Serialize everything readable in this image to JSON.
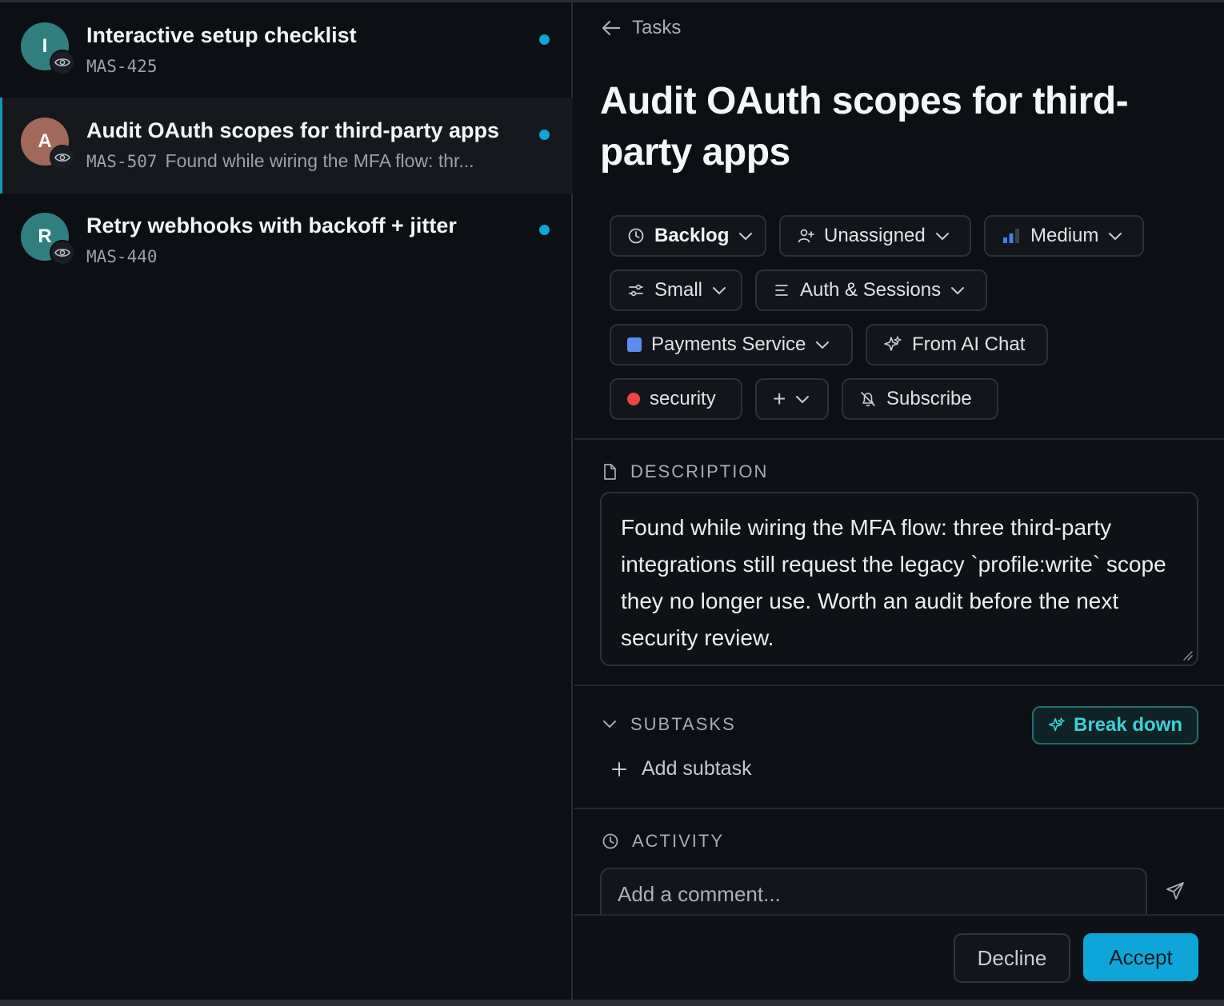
{
  "list": {
    "items": [
      {
        "initial": "I",
        "title": "Interactive setup checklist",
        "id": "MAS-425",
        "snippet": "",
        "avatar_color": "#2f7f80"
      },
      {
        "initial": "A",
        "title": "Audit OAuth scopes for third-party apps",
        "id": "MAS-507",
        "snippet": "Found while wiring the MFA flow: thr...",
        "avatar_color": "#a0695a"
      },
      {
        "initial": "R",
        "title": "Retry webhooks with backoff + jitter",
        "id": "MAS-440",
        "snippet": "",
        "avatar_color": "#2f7f80"
      }
    ],
    "unread_dot_color": "#0ea5d8"
  },
  "detail": {
    "back_label": "Tasks",
    "title": "Audit OAuth scopes for third-party apps",
    "chips": {
      "status": "Backlog",
      "assignee": "Unassigned",
      "priority": "Medium",
      "size": "Small",
      "area": "Auth & Sessions",
      "project": "Payments Service",
      "source": "From AI Chat",
      "label": "security",
      "add": "+",
      "subscribe": "Subscribe"
    },
    "colors": {
      "project": "#5b8def",
      "label": "#ef4444",
      "priority": "#3b82f6",
      "accent": "#0ea5d8",
      "breakdown": "#3ed0d8"
    },
    "description_heading": "DESCRIPTION",
    "description": "Found while wiring the MFA flow: three third-party integrations still request the legacy `profile:write` scope they no longer use. Worth an audit before the next security review.",
    "subtasks_heading": "SUBTASKS",
    "break_down_label": "Break down",
    "add_subtask_label": "Add subtask",
    "activity_heading": "ACTIVITY",
    "comment_placeholder": "Add a comment...",
    "decline_label": "Decline",
    "accept_label": "Accept"
  }
}
